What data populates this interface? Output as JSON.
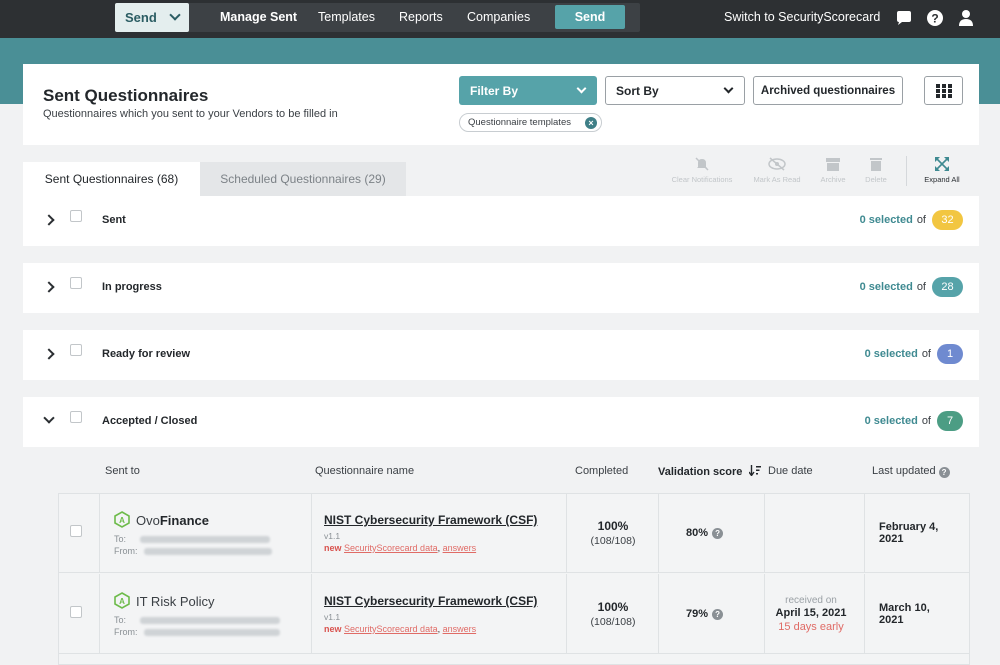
{
  "nav": {
    "send_dropdown": "Send",
    "links": [
      "Manage Sent",
      "Templates",
      "Reports",
      "Companies"
    ],
    "send_button": "Send",
    "switch": "Switch to SecurityScorecard"
  },
  "header": {
    "title": "Sent Questionnaires",
    "subtitle": "Questionnaires which you sent to your Vendors to be filled in",
    "filter_label": "Filter By",
    "sort_label": "Sort By",
    "archived_label": "Archived questionnaires",
    "chip": "Questionnaire templates"
  },
  "tabs": {
    "sent": "Sent Questionnaires (68)",
    "scheduled": "Scheduled Questionnaires (29)"
  },
  "toolbar": {
    "clear": "Clear Notifications",
    "mark": "Mark As Read",
    "archive": "Archive",
    "delete": "Delete",
    "expand": "Expand All"
  },
  "groups": [
    {
      "label": "Sent",
      "selected": "0 selected",
      "of": "of",
      "count": "32",
      "color": "#f2c641"
    },
    {
      "label": "In progress",
      "selected": "0 selected",
      "of": "of",
      "count": "28",
      "color": "#56a3a9"
    },
    {
      "label": "Ready for review",
      "selected": "0 selected",
      "of": "of",
      "count": "1",
      "color": "#6f8ad0"
    },
    {
      "label": "Accepted / Closed",
      "selected": "0 selected",
      "of": "of",
      "count": "7",
      "color": "#4c9d84"
    }
  ],
  "columns": {
    "sent_to": "Sent to",
    "name": "Questionnaire name",
    "completed": "Completed",
    "score": "Validation score",
    "due": "Due date",
    "updated": "Last updated"
  },
  "rows": [
    {
      "grade": "A",
      "vendor_prefix": "Ovo",
      "vendor_suffix": "Finance",
      "to": "To:",
      "from": "From:",
      "q_name": "NIST Cybersecurity Framework (CSF)",
      "version": "v1.1",
      "new": "new",
      "ssc_link": "SecurityScorecard data",
      "answers_link": "answers",
      "completed": "100%",
      "completed_sub": "(108/108)",
      "score": "80%",
      "updated_1": "February 4,",
      "updated_2": "2021"
    },
    {
      "grade": "A",
      "vendor": "IT Risk Policy",
      "to": "To:",
      "from": "From:",
      "q_name": "NIST Cybersecurity Framework (CSF)",
      "version": "v1.1",
      "new": "new",
      "ssc_link": "SecurityScorecard data",
      "answers_link": "answers",
      "completed": "100%",
      "completed_sub": "(108/108)",
      "score": "79%",
      "due_1": "received on",
      "due_2": "April 15, 2021",
      "due_3": "15 days early",
      "updated_1": "March 10,",
      "updated_2": "2021"
    }
  ]
}
